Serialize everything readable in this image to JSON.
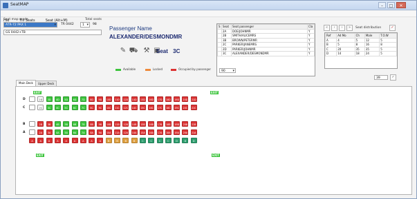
{
  "window": {
    "title": "SeatMAP",
    "controls": [
      "–",
      "□",
      "✕"
    ]
  },
  "menu": [
    "File",
    "Fill Seats",
    "Seat (Alt+M)"
  ],
  "form": {
    "seat_map_mode_label": "Seat map mode",
    "total_seats_label": "Total seats",
    "mode_value": "ATR-72 PAX 1",
    "aircraft_code": "TR 0442",
    "count_value": "1",
    "total_value": "98",
    "flight_value": "GS 0442+TB"
  },
  "passenger": {
    "title": "Passenger Name",
    "name": "ALEXANDER/DESMONDMR",
    "seat_label": "Seat",
    "seat_value": "3C"
  },
  "tools": [
    "pin-icon",
    "car-icon",
    "wrench-icon",
    "monitor-icon"
  ],
  "legend": [
    {
      "label": "Available",
      "color": "#3cc43c"
    },
    {
      "label": "Locked",
      "color": "#ee8a3c"
    },
    {
      "label": "Occupied by passenger",
      "color": "#dc3232"
    }
  ],
  "passenger_list": {
    "headers": [
      "S",
      "Seat",
      "Seat passenger",
      "Cla"
    ],
    "rows": [
      [
        "",
        "2A",
        "DOE/JOHNMR",
        "Y"
      ],
      [
        "",
        "2B",
        "SMITH/ALICEMRS",
        "Y"
      ],
      [
        "",
        "3B",
        "BROWN/PETERMR",
        "Y"
      ],
      [
        "",
        "2C",
        "PARKER/JANEMRS",
        "Y"
      ],
      [
        "",
        "2D",
        "PARKER/JOHNMR",
        "Y"
      ],
      [
        "",
        "3C",
        "ALEXANDER/DESMONDMR",
        "Y"
      ]
    ],
    "footer_value": "90"
  },
  "distribution": {
    "title": "Seat distribution",
    "headers": [
      "Ref",
      "Ad Mo",
      "Ch",
      "Male",
      "T.O.W"
    ],
    "rows": [
      [
        "A",
        "4",
        "5",
        "12",
        "5"
      ],
      [
        "B",
        "5",
        "8",
        "16",
        "8"
      ],
      [
        "C",
        "20",
        "35",
        "35",
        "5"
      ],
      [
        "D",
        "14",
        "18",
        "24",
        "5"
      ]
    ],
    "total_value": "39"
  },
  "tabs": [
    "Main Deck",
    "Upper Deck"
  ],
  "deck": {
    "exits": [
      "EXIT",
      "EXIT",
      "EXIT",
      "EXIT"
    ],
    "rows": [
      {
        "label": "D",
        "seats": [
          "",
          "2D",
          "3D",
          "4D",
          "5D",
          "6D",
          "7D",
          "8D",
          "9D",
          "10D",
          "11D",
          "12D",
          "14D",
          "15D",
          "16D",
          "17D",
          "18D",
          "19D",
          "20D",
          "21D"
        ]
      },
      {
        "label": "C",
        "seats": [
          "",
          "2C",
          "3C",
          "4C",
          "5C",
          "6C",
          "7C",
          "8C",
          "9C",
          "10C",
          "11C",
          "12C",
          "14C",
          "15C",
          "16C",
          "17C",
          "18C",
          "19C",
          "20C",
          "21C"
        ]
      },
      {
        "label": "B",
        "seats": [
          "",
          "2B",
          "3B",
          "4B",
          "5B",
          "6B",
          "7B",
          "8B",
          "9B",
          "10B",
          "11B",
          "12B",
          "14B",
          "15B",
          "16B",
          "17B",
          "18B",
          "19B",
          "20B",
          "21B"
        ]
      },
      {
        "label": "A",
        "seats": [
          "",
          "2A",
          "3A",
          "4A",
          "5A",
          "6A",
          "7A",
          "8A",
          "9A",
          "10A",
          "11A",
          "12A",
          "14A",
          "15A",
          "16A",
          "17A",
          "18A",
          "19A",
          "20A",
          "21A"
        ]
      }
    ],
    "zone_row": [
      "A",
      "A",
      "A",
      "A",
      "A",
      "A",
      "A",
      "A",
      "A",
      "B",
      "B",
      "B",
      "B",
      "C",
      "C",
      "C",
      "C",
      "D",
      "D",
      "D"
    ]
  }
}
